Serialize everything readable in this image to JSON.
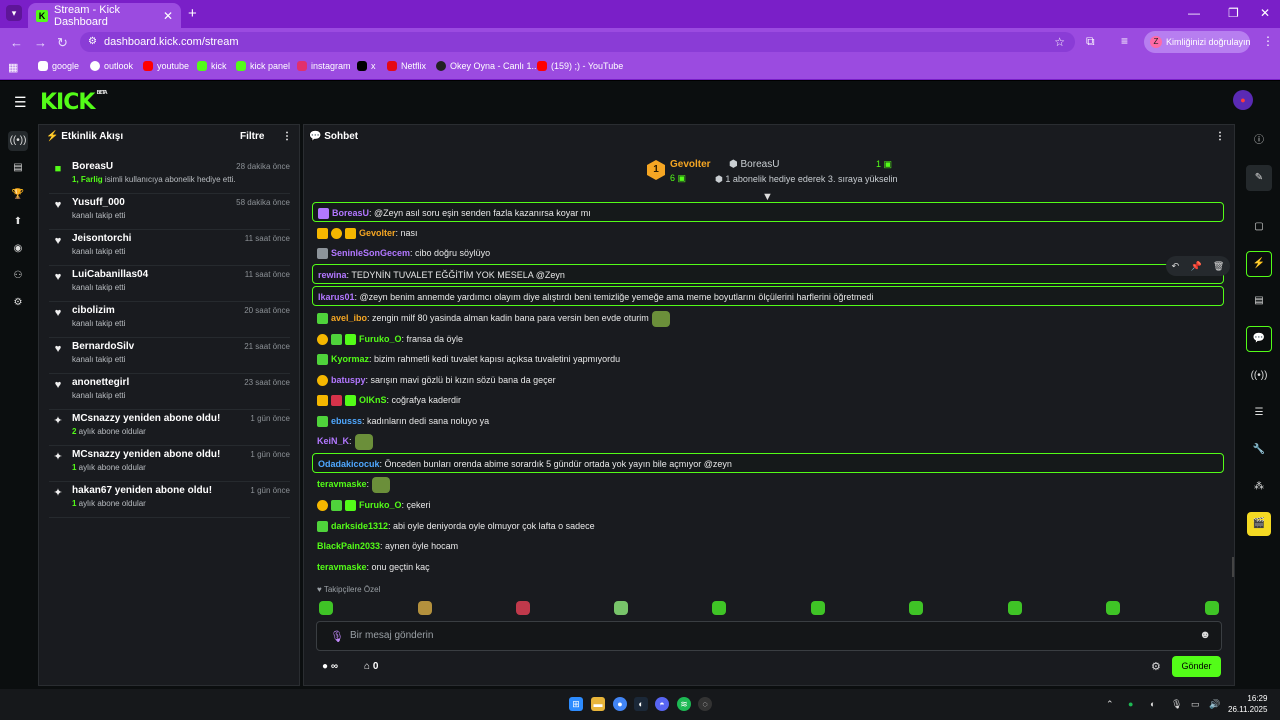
{
  "browser": {
    "tab_title": "Stream - Kick Dashboard",
    "url": "dashboard.kick.com/stream",
    "verify_label": "Kimliğinizi doğrulayın",
    "bookmarks": [
      "google",
      "outlook",
      "youtube",
      "kick",
      "kick panel",
      "instagram",
      "x",
      "Netflix",
      "Okey Oyna - Canlı 1...",
      "(159) ;) - YouTube"
    ]
  },
  "header": {
    "logo": "KICK",
    "logo_badge": "BETA"
  },
  "activity": {
    "title": "Etkinlik Akışı",
    "filter_label": "Filtre",
    "items": [
      {
        "name": "BoreasU",
        "time": "28 dakika önce",
        "desc_strong": "1, Farlig",
        "desc": " isimli kullanıcıya abonelik hediye etti.",
        "icon": "gift-icon"
      },
      {
        "name": "Yusuff_000",
        "time": "58 dakika önce",
        "desc_strong": "",
        "desc": "kanalı takip etti",
        "icon": "heart-icon"
      },
      {
        "name": "Jeisontorchi",
        "time": "11 saat önce",
        "desc_strong": "",
        "desc": "kanalı takip etti",
        "icon": "heart-icon"
      },
      {
        "name": "LuiCabanillas04",
        "time": "11 saat önce",
        "desc_strong": "",
        "desc": "kanalı takip etti",
        "icon": "heart-icon"
      },
      {
        "name": "cibolizim",
        "time": "20 saat önce",
        "desc_strong": "",
        "desc": "kanalı takip etti",
        "icon": "heart-icon"
      },
      {
        "name": "BernardoSilv",
        "time": "21 saat önce",
        "desc_strong": "",
        "desc": "kanalı takip etti",
        "icon": "heart-icon"
      },
      {
        "name": "anonettegirl",
        "time": "23 saat önce",
        "desc_strong": "",
        "desc": "kanalı takip etti",
        "icon": "heart-icon"
      },
      {
        "name": "MCsnazzy yeniden abone oldu!",
        "time": "1 gün önce",
        "desc_strong": "2",
        "desc": " aylık abone oldular",
        "icon": "sparkle-icon"
      },
      {
        "name": "MCsnazzy yeniden abone oldu!",
        "time": "1 gün önce",
        "desc_strong": "1",
        "desc": " aylık abone oldular",
        "icon": "sparkle-icon"
      },
      {
        "name": "hakan67 yeniden abone oldu!",
        "time": "1 gün önce",
        "desc_strong": "1",
        "desc": " aylık abone oldular",
        "icon": "sparkle-icon"
      }
    ]
  },
  "chat": {
    "title": "Sohbet",
    "pinned": {
      "gifter_name": "Gevolter",
      "gifter_count": "6",
      "recipient_name": "BoreasU",
      "recipient_count": "1",
      "desc": "1 abonelik hediye ederek 3. sıraya yükselin"
    },
    "messages": [
      {
        "user": "BoreasU",
        "color": "#b277ff",
        "text": ": @Zeyn asıl soru eşin senden fazla kazanırsa koyar mı",
        "hl": true,
        "badges": [
          "b-purple"
        ]
      },
      {
        "user": "Gevolter",
        "color": "#f5a623",
        "text": ": nası",
        "hl": false,
        "badges": [
          "b-crown",
          "b-coin",
          "b-crown"
        ]
      },
      {
        "user": "SeninleSonGecem",
        "color": "#b277ff",
        "text": ": cibo doğru söylüyo",
        "hl": false,
        "badges": [
          "b-grey"
        ]
      },
      {
        "user": "rewina",
        "color": "#b277ff",
        "text": ": TEDYNİN TUVALET EĞĞİTİM YOK MESELA @Zeyn",
        "hl": true,
        "badges": []
      },
      {
        "user": "Ikarus01",
        "color": "#b277ff",
        "text": ": @zeyn benim annemde yardımcı olayım diye alıştırdı beni temizliğe yemeğe ama meme boyutlarını ölçülerini harflerini öğretmedi",
        "hl": true,
        "badges": []
      },
      {
        "user": "avel_ibo",
        "color": "#f5a623",
        "text": ": zengin milf 80 yasinda alman kadin bana para versin ben evde oturim",
        "hl": false,
        "badges": [
          "b-frog"
        ],
        "emote": true
      },
      {
        "user": "Furuko_O",
        "color": "#53fc18",
        "text": ": fransa da öyle",
        "hl": false,
        "badges": [
          "b-coin",
          "b-frog",
          "b-sub"
        ]
      },
      {
        "user": "Kyormaz",
        "color": "#53fc18",
        "text": ": bizim rahmetli kedi tuvalet kapısı açıksa tuvaletini yapmıyordu",
        "hl": false,
        "badges": [
          "b-frog"
        ]
      },
      {
        "user": "batuspy",
        "color": "#b277ff",
        "text": ": sarışın mavi gözlü bi kızın sözü bana da geçer",
        "hl": false,
        "badges": [
          "b-coin"
        ]
      },
      {
        "user": "OlKnS",
        "color": "#53fc18",
        "text": ": coğrafya kaderdir",
        "hl": false,
        "badges": [
          "b-crown",
          "b-red",
          "b-sub"
        ]
      },
      {
        "user": "ebusss",
        "color": "#4fa8ff",
        "text": ": kadınların dedi sana noluyo ya",
        "hl": false,
        "badges": [
          "b-frog"
        ]
      },
      {
        "user": "KeiN_K",
        "color": "#b277ff",
        "text": ":",
        "hl": false,
        "badges": [],
        "emote": true
      },
      {
        "user": "Odadakicocuk",
        "color": "#4fa8ff",
        "text": ": Önceden bunları orenda abime sorardık 5 gündür ortada yok yayın bile açmıyor @zeyn",
        "hl": true,
        "badges": []
      },
      {
        "user": "teravmaske",
        "color": "#53fc18",
        "text": ":",
        "hl": false,
        "badges": [],
        "emote": true
      },
      {
        "user": "Furuko_O",
        "color": "#53fc18",
        "text": ": çekeri",
        "hl": false,
        "badges": [
          "b-coin",
          "b-frog",
          "b-sub"
        ]
      },
      {
        "user": "darkside1312",
        "color": "#53fc18",
        "text": ": abi oyle deniyorda oyle olmuyor çok lafta o sadece",
        "hl": false,
        "badges": [
          "b-frog"
        ]
      },
      {
        "user": "BlackPain2033",
        "color": "#53fc18",
        "text": ": aynen öyle hocam",
        "hl": false,
        "badges": []
      },
      {
        "user": "teravmaske",
        "color": "#53fc18",
        "text": ": onu geçtin kaç",
        "hl": false,
        "badges": []
      }
    ],
    "followers_label": "Takipçilere Özel",
    "input_placeholder": "Bir mesaj gönderin",
    "infinity_label": "∞",
    "store_count": "0",
    "send_label": "Gönder"
  },
  "taskbar": {
    "time": "16:29",
    "date": "26.11.2025"
  }
}
